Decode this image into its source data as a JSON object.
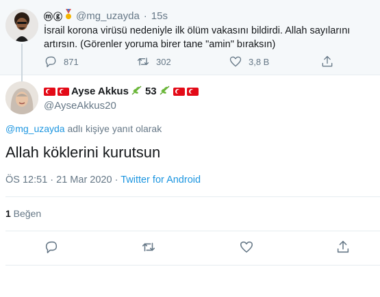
{
  "parent_tweet": {
    "author_emoji": "ⓜⓖ",
    "handle": "@mg_uzayda",
    "separator": "·",
    "time": "15s",
    "text": "İsrail korona virüsü nedeniyle ilk ölüm vakasını bildirdi. Allah sayılarını artırsın. (Görenler yoruma birer tane \"amin\" bıraksın)",
    "replies": "871",
    "retweets": "302",
    "likes": "3,8 B"
  },
  "main_tweet": {
    "name": "Ayse Akkus",
    "name_number": "53",
    "handle": "@AyseAkkus20",
    "reply_mention": "@mg_uzayda",
    "reply_suffix": " adlı kişiye yanıt olarak",
    "text": "Allah köklerini kurutsun",
    "time": "ÖS 12:51 · 21 Mar 2020 · ",
    "source": "Twitter for Android",
    "like_count": "1",
    "like_label": " Beğen"
  },
  "icons": {
    "reply": "reply-icon",
    "retweet": "retweet-icon",
    "like": "heart-icon",
    "share": "share-icon",
    "flag": "turkey-flag-icon",
    "leaf": "olive-branch-icon",
    "medal": "medal-icon"
  },
  "colors": {
    "link": "#1b95e0",
    "muted": "#657786",
    "text": "#14171a",
    "parent_bg": "#f5f8fa",
    "flag_red": "#e30a17"
  }
}
